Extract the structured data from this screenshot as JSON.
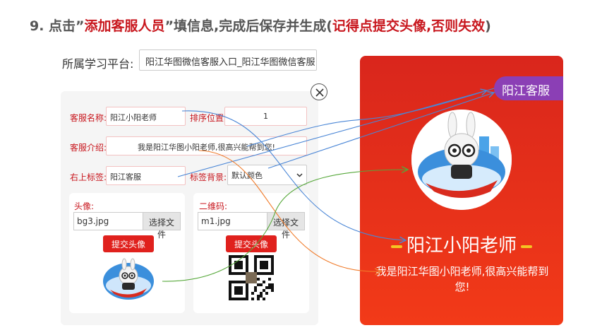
{
  "heading": {
    "prefix": "9. 点击”",
    "highlight": "添加客服人员",
    "middle": "”填信息,完成后保存并生成(",
    "note": "记得点提交头像,否则失效",
    "suffix": ")"
  },
  "platform": {
    "label": "所属学习平台:",
    "value": "阳江华图微信客服入口_阳江华图微信客服"
  },
  "form": {
    "name_label": "客服名称:",
    "name_value": "阳江小阳老师",
    "order_label": "排序位置:",
    "order_value": "1",
    "intro_label": "客服介绍:",
    "intro_value": "我是阳江华图小阳老师,很高兴能帮到您!",
    "tag_label": "右上标签:",
    "tag_value": "阳江客服",
    "tag_bg_label": "标签背景:",
    "tag_bg_value": "默认颜色"
  },
  "avatar_upload": {
    "label": "头像:",
    "file": "bg3.jpg",
    "choose": "选择文件",
    "submit": "提交头像"
  },
  "qrcode_upload": {
    "label": "二维码:",
    "file": "m1.jpg",
    "choose": "选择文件",
    "submit": "提交头像"
  },
  "preview": {
    "tag": "阳江客服",
    "name": "阳江小阳老师",
    "intro": "我是阳江华图小阳老师,很高兴能帮到您!"
  },
  "colors": {
    "accent_red": "#c8161d",
    "preview_bg": "#e52d1b",
    "tag_purple": "#8b3fb5",
    "dash_yellow": "#f5c423"
  },
  "icons": [
    "close-icon",
    "chevron-down-icon",
    "mascot-avatar",
    "qr-code"
  ]
}
